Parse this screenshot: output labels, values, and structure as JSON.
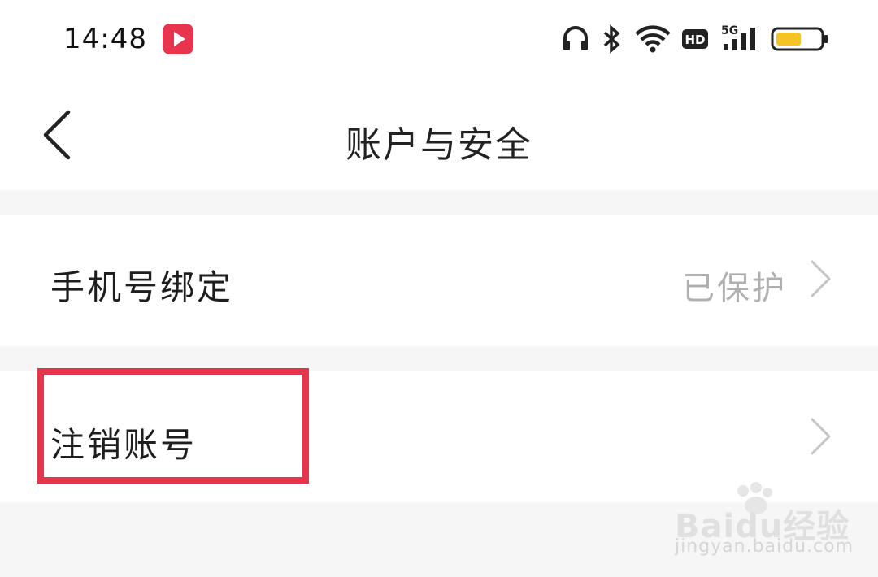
{
  "status_bar": {
    "time": "14:48",
    "icons": [
      "app-badge-icon",
      "headphones-icon",
      "bluetooth-icon",
      "wifi-icon",
      "hd-icon",
      "signal-5g-icon",
      "battery-icon"
    ],
    "network": "5G",
    "hd": "HD"
  },
  "header": {
    "title": "账户与安全"
  },
  "settings": {
    "rows": [
      {
        "label": "手机号绑定",
        "value": "已保护"
      },
      {
        "label": "注销账号",
        "value": ""
      }
    ]
  },
  "colors": {
    "accent": "#e5344b",
    "battery": "#f5c326",
    "muted": "#b0b0b0"
  },
  "watermark": {
    "brand": "Baidu经验",
    "url": "jingyan.baidu.com"
  }
}
